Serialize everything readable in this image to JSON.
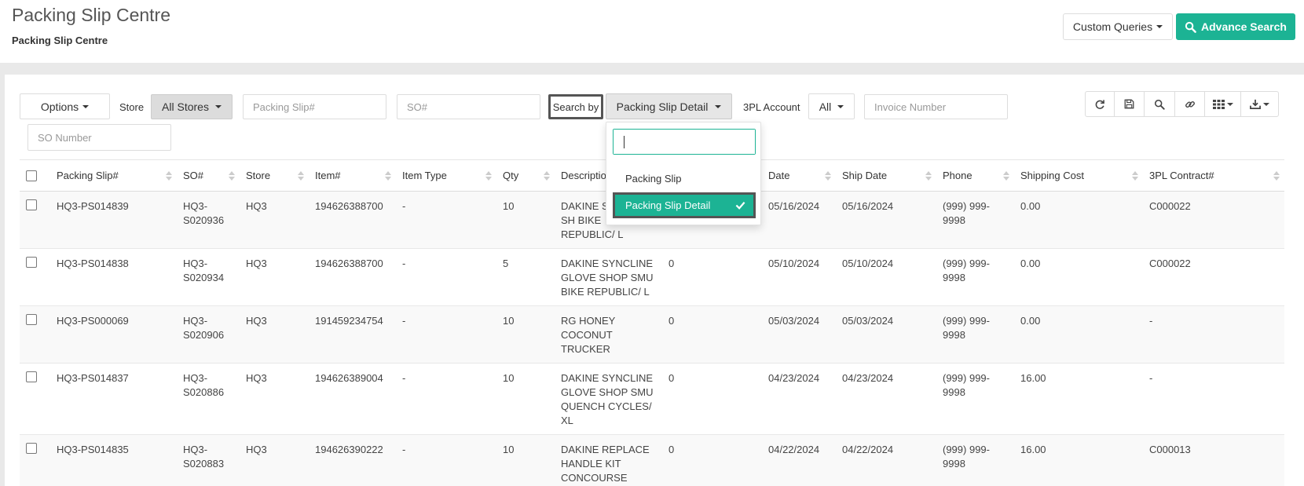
{
  "header": {
    "title": "Packing Slip Centre",
    "subtitle": "Packing Slip Centre",
    "custom_queries_label": "Custom Queries",
    "advance_search_label": "Advance Search"
  },
  "filters": {
    "options_label": "Options",
    "store_label": "Store",
    "store_value": "All Stores",
    "packing_slip_placeholder": "Packing Slip#",
    "so_placeholder": "SO#",
    "search_by_label": "Search by",
    "search_by_value": "Packing Slip Detail",
    "tpl_account_label": "3PL Account",
    "tpl_account_value": "All",
    "invoice_placeholder": "Invoice Number",
    "so_number_placeholder": "SO Number"
  },
  "search_by_dropdown": {
    "search_value": "",
    "options": [
      "Packing Slip",
      "Packing Slip Detail"
    ],
    "selected": "Packing Slip Detail"
  },
  "toolbar": {
    "icons": [
      "refresh-icon",
      "save-icon",
      "search-icon",
      "link-icon",
      "columns-icon",
      "download-icon"
    ]
  },
  "table": {
    "columns": [
      "Packing Slip#",
      "SO#",
      "Store",
      "Item#",
      "Item Type",
      "Qty",
      "Description",
      "",
      "Date",
      "Ship Date",
      "Phone",
      "Shipping Cost",
      "3PL Contract#"
    ],
    "rows": [
      [
        "HQ3-PS014839",
        "HQ3-S020936",
        "HQ3",
        "194626388700",
        "-",
        "10",
        "DAKINE S GLOVE SH BIKE REPUBLIC/ L",
        "",
        "05/16/2024",
        "05/16/2024",
        "(999) 999-9998",
        "0.00",
        "C000022"
      ],
      [
        "HQ3-PS014838",
        "HQ3-S020934",
        "HQ3",
        "194626388700",
        "-",
        "5",
        "DAKINE SYNCLINE GLOVE SHOP SMU BIKE REPUBLIC/ L",
        "0",
        "05/10/2024",
        "05/10/2024",
        "(999) 999-9998",
        "0.00",
        "C000022"
      ],
      [
        "HQ3-PS000069",
        "HQ3-S020906",
        "HQ3",
        "191459234754",
        "-",
        "10",
        "RG HONEY COCONUT TRUCKER",
        "0",
        "05/03/2024",
        "05/03/2024",
        "(999) 999-9998",
        "0.00",
        "-"
      ],
      [
        "HQ3-PS014837",
        "HQ3-S020886",
        "HQ3",
        "194626389004",
        "-",
        "10",
        "DAKINE SYNCLINE GLOVE SHOP SMU QUENCH CYCLES/ XL",
        "0",
        "04/23/2024",
        "04/23/2024",
        "(999) 999-9998",
        "16.00",
        "-"
      ],
      [
        "HQ3-PS014835",
        "HQ3-S020883",
        "HQ3",
        "194626390222",
        "-",
        "10",
        "DAKINE REPLACE HANDLE KIT CONCOURSE HARDSIDE -SM",
        "0",
        "04/22/2024",
        "04/22/2024",
        "(999) 999-9998",
        "16.00",
        "C000013"
      ]
    ]
  },
  "colors": {
    "accent": "#1cb394",
    "header_bg": "#ffffff",
    "page_bg": "#e9e9e9"
  }
}
